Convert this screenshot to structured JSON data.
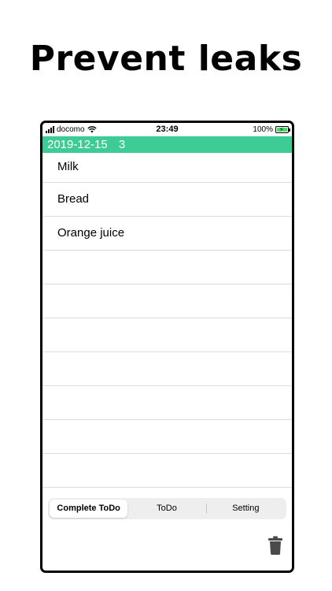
{
  "headline": "Prevent leaks",
  "status_bar": {
    "carrier": "docomo",
    "time": "23:49",
    "battery": "100%"
  },
  "nav": {
    "date": "2019-12-15",
    "count": "3",
    "background": "#3ecb96"
  },
  "items": [
    {
      "label": "Milk"
    },
    {
      "label": "Bread"
    },
    {
      "label": "Orange juice"
    },
    {
      "label": ""
    },
    {
      "label": ""
    },
    {
      "label": ""
    },
    {
      "label": ""
    },
    {
      "label": ""
    },
    {
      "label": ""
    },
    {
      "label": ""
    }
  ],
  "tabs": [
    {
      "label": "Complete ToDo",
      "selected": true
    },
    {
      "label": "ToDo",
      "selected": false
    },
    {
      "label": "Setting",
      "selected": false
    }
  ],
  "icons": {
    "signal": "signal-icon",
    "wifi": "wifi-icon",
    "battery": "battery-icon",
    "trash": "trash-icon"
  }
}
